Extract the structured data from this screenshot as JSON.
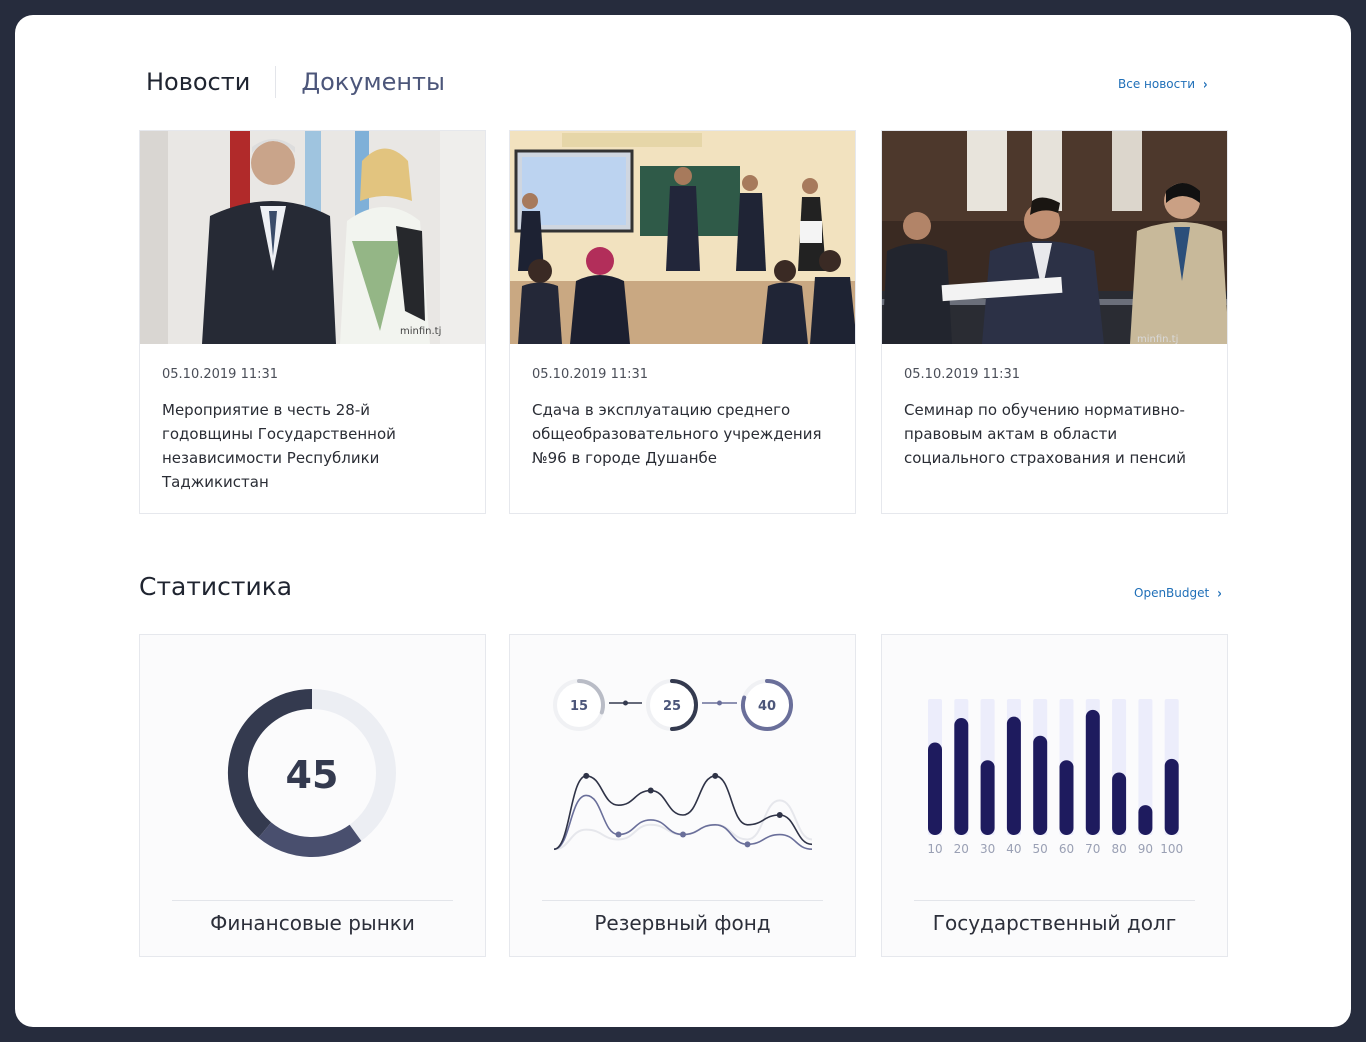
{
  "tabs": {
    "news": "Новости",
    "documents": "Документы"
  },
  "news_link": "Все новости",
  "news": [
    {
      "date": "05.10.2019 11:31",
      "title": "Мероприятие в честь 28-й годовщины Государственной независимости Республики Таджикистан",
      "watermark": "minfin.tj"
    },
    {
      "date": "05.10.2019 11:31",
      "title": "Сдача в эксплуатацию среднего общеобразовательного учреждения №96 в городе Душанбе"
    },
    {
      "date": "05.10.2019 11:31",
      "title": "Семинар по обучению нормативно-правовым актам в области социального страхования и пенсий",
      "watermark": "minfin.tj"
    }
  ],
  "stats_title": "Статистика",
  "stats_link": "OpenBudget",
  "stats": [
    {
      "label": "Финансовые рынки",
      "gauge_value": "45",
      "gauge_fraction": 0.6
    },
    {
      "label": "Резервный фонд",
      "steps": [
        "15",
        "25",
        "40"
      ],
      "step_fractions": [
        0.3,
        0.5,
        0.8
      ]
    },
    {
      "label": "Государственный долг"
    }
  ],
  "chart_data": [
    {
      "type": "donut",
      "value": 45,
      "filled_fraction": 0.6
    },
    {
      "type": "line",
      "series": [
        {
          "values": [
            1,
            8.5,
            5.5,
            7,
            4.5,
            8.5,
            3.5,
            4.5,
            1.5
          ]
        },
        {
          "values": [
            1,
            6.5,
            2.5,
            4,
            2.5,
            3.5,
            1.5,
            2.5,
            1
          ]
        },
        {
          "values": [
            1,
            3,
            2,
            3.5,
            2.5,
            3.5,
            2,
            6,
            2
          ]
        }
      ]
    },
    {
      "type": "bar",
      "categories": [
        "10",
        "20",
        "30",
        "40",
        "50",
        "60",
        "70",
        "80",
        "90",
        "100"
      ],
      "values": [
        68,
        86,
        55,
        87,
        73,
        55,
        92,
        46,
        22,
        56
      ],
      "ylim": [
        0,
        100
      ],
      "colors": {
        "bar": "#1e1b5e",
        "track": "#ecedfb"
      }
    }
  ],
  "colors": {
    "accent": "#1f6fb8",
    "gauge": "#343a4f",
    "gauge_light": "#494f6e",
    "track": "#eceef3",
    "line_dark": "#2f3347",
    "line_mid": "#6a6f9a"
  }
}
